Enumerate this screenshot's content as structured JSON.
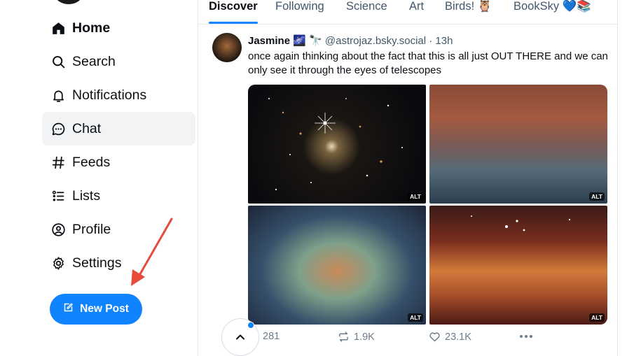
{
  "sidebar": {
    "items": [
      {
        "label": "Home",
        "icon": "home-icon"
      },
      {
        "label": "Search",
        "icon": "search-icon"
      },
      {
        "label": "Notifications",
        "icon": "bell-icon"
      },
      {
        "label": "Chat",
        "icon": "chat-icon"
      },
      {
        "label": "Feeds",
        "icon": "hash-icon"
      },
      {
        "label": "Lists",
        "icon": "list-icon"
      },
      {
        "label": "Profile",
        "icon": "profile-icon"
      },
      {
        "label": "Settings",
        "icon": "gear-icon"
      }
    ],
    "new_post_label": "New Post"
  },
  "feed_tabs": [
    {
      "label": "Discover",
      "active": true
    },
    {
      "label": "Following"
    },
    {
      "label": "Science"
    },
    {
      "label": "Art"
    },
    {
      "label": "Birds! 🦉"
    },
    {
      "label": "BookSky 💙📚"
    }
  ],
  "post": {
    "author_name": "Jasmine",
    "author_emoji": "🌌 🔭",
    "handle": "@astrojaz.bsky.social",
    "time": "· 13h",
    "text": "once again thinking about the fact that this is all just OUT THERE and we can only see it through the eyes of telescopes",
    "image_alt_badge": "ALT",
    "replies": "281",
    "reposts": "1.9K",
    "likes": "23.1K"
  },
  "colors": {
    "accent": "#1083fe",
    "annotation_arrow": "#e84a3c"
  }
}
